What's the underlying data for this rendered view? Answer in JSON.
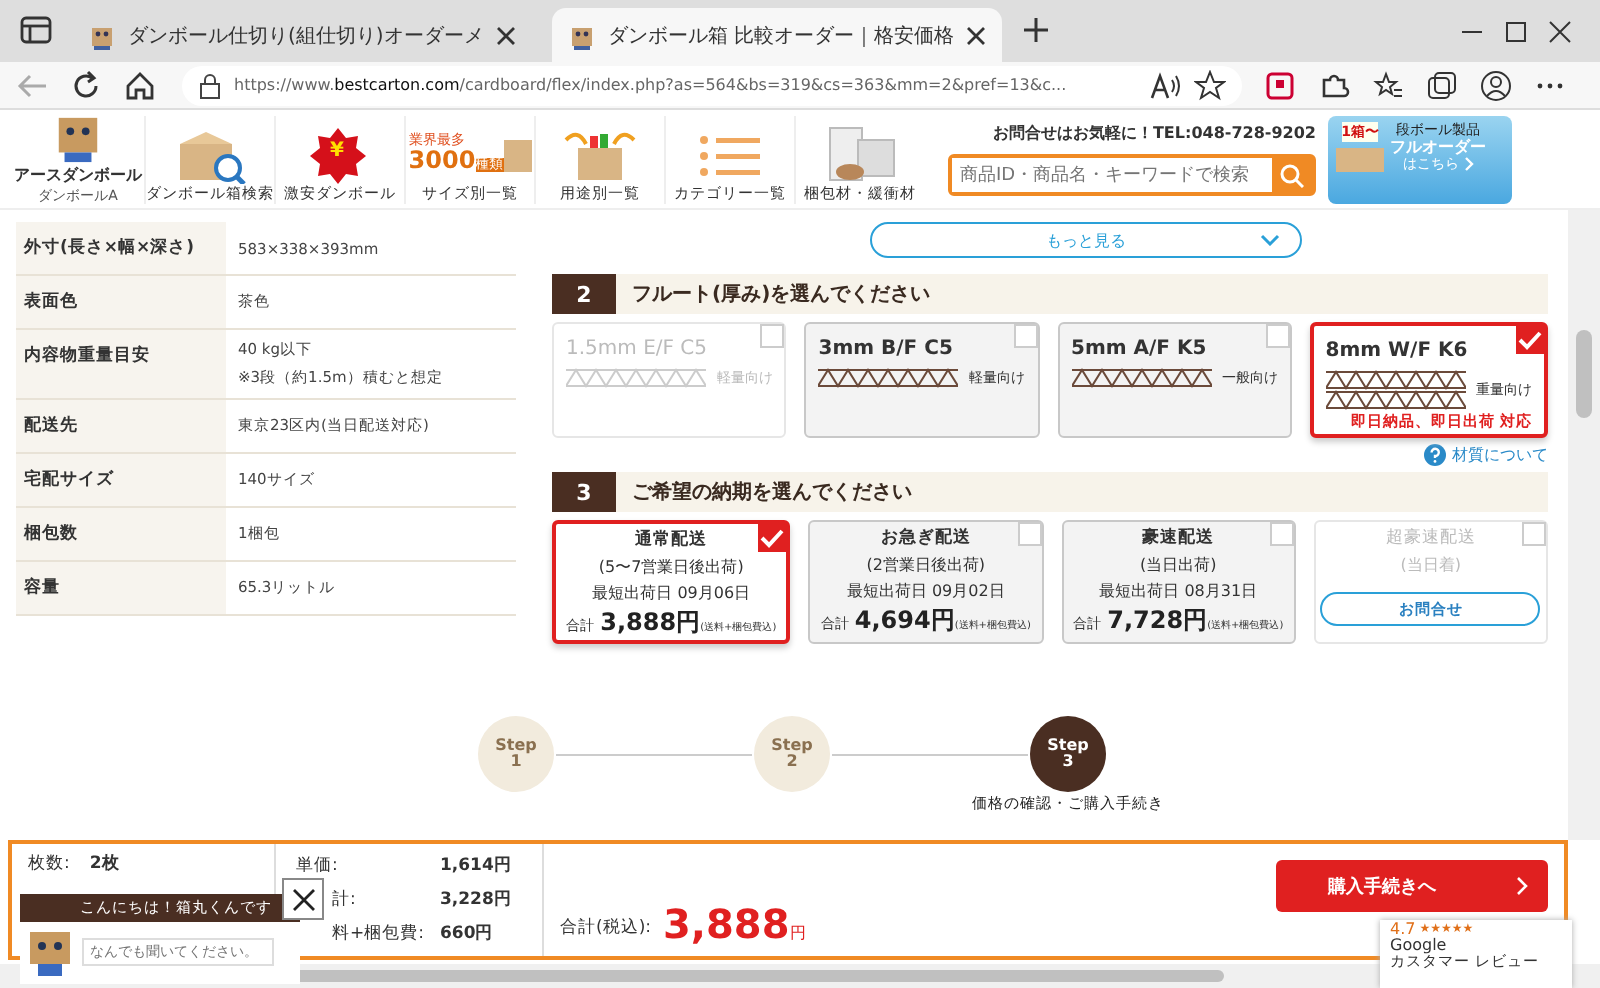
{
  "browser": {
    "tabs": [
      {
        "title": "ダンボール仕切り(組仕切り)オーダーメ",
        "selected": false
      },
      {
        "title": "ダンボール箱 比較オーダー｜格安価格",
        "selected": true
      }
    ],
    "url_prefix": "https://www.",
    "url_host": "bestcarton.com",
    "url_path": "/cardboard/flex/index.php?as=564&bs=319&cs=363&mm=2&pref=13&c..."
  },
  "header": {
    "logo": "アースダンボール",
    "logo_sub": "ダンボールA",
    "nav": [
      {
        "label": "ダンボール箱検索",
        "kind": "search"
      },
      {
        "label": "激安ダンボール",
        "kind": "sale",
        "badge": "¥"
      },
      {
        "label": "サイズ別一覧",
        "kind": "size",
        "badge_top": "業界最多",
        "badge_num": "3000",
        "badge_unit": "種類"
      },
      {
        "label": "用途別一覧",
        "kind": "use"
      },
      {
        "label": "カテゴリー一覧",
        "kind": "list"
      },
      {
        "label": "梱包材・緩衝材",
        "kind": "pack"
      }
    ],
    "contact": "お問合せはお気軽に！TEL:048-728-9202",
    "search": {
      "placeholder": "商品ID・商品名・キーワードで検索"
    },
    "banner": {
      "top": "1箱〜",
      "right_top": "段ボール製品",
      "main": "フルオーダー",
      "link": "はこちら"
    }
  },
  "specs": [
    {
      "label": "外寸(長さ×幅×深さ)",
      "values": [
        "583×338×393mm"
      ]
    },
    {
      "label": "表面色",
      "values": [
        "茶色"
      ]
    },
    {
      "label": "内容物重量目安",
      "values": [
        "40 kg以下",
        "※3段（約1.5m）積むと想定"
      ]
    },
    {
      "label": "配送先",
      "values": [
        "東京23区内(当日配送対応)"
      ]
    },
    {
      "label": "宅配サイズ",
      "values": [
        "140サイズ"
      ]
    },
    {
      "label": "梱包数",
      "values": [
        "1梱包"
      ]
    },
    {
      "label": "容量",
      "values": [
        "65.3リットル"
      ]
    }
  ],
  "more_button": "もっと見る",
  "flute": {
    "number": "2",
    "title": "フルート(厚み)を選んでください",
    "options": [
      {
        "name": "1.5mm E/F C5",
        "usage": "軽量向け",
        "kind": "single",
        "selected": false,
        "disabled": true
      },
      {
        "name": "3mm B/F C5",
        "usage": "軽量向け",
        "kind": "single",
        "selected": false,
        "disabled": false
      },
      {
        "name": "5mm A/F K5",
        "usage": "一般向け",
        "kind": "single",
        "selected": false,
        "disabled": false
      },
      {
        "name": "8mm W/F K6",
        "usage": "重量向け",
        "kind": "double",
        "note": "即日納品、即日出荷 対応",
        "selected": true,
        "disabled": false
      }
    ],
    "link": "材質について"
  },
  "delivery": {
    "number": "3",
    "title": "ご希望の納期を選んでください",
    "options": [
      {
        "name": "通常配送",
        "sub": "(5〜7営業日後出荷)",
        "date": "最短出荷日 09月06日",
        "total_label": "合計",
        "price": "3,888円",
        "price_note": "(送料+梱包費込)",
        "selected": true,
        "disabled": false
      },
      {
        "name": "お急ぎ配送",
        "sub": "(2営業日後出荷)",
        "date": "最短出荷日 09月02日",
        "total_label": "合計",
        "price": "4,694円",
        "price_note": "(送料+梱包費込)",
        "selected": false,
        "disabled": false
      },
      {
        "name": "豪速配送",
        "sub": "(当日出荷)",
        "date": "最短出荷日 08月31日",
        "total_label": "合計",
        "price": "7,728円",
        "price_note": "(送料+梱包費込)",
        "selected": false,
        "disabled": false
      },
      {
        "name": "超豪速配送",
        "sub": "(当日着)",
        "button": "お問合せ",
        "selected": false,
        "disabled": true
      }
    ]
  },
  "steps": [
    {
      "label": "Step",
      "number": "1",
      "selected": false
    },
    {
      "label": "Step",
      "number": "2",
      "selected": false
    },
    {
      "label": "Step",
      "number": "3",
      "selected": true,
      "caption": "価格の確認・ご購入手続き"
    }
  ],
  "summary": {
    "qty_label": "枚数:",
    "qty": "2枚",
    "prices": [
      {
        "label": "単価:",
        "value": "1,614円"
      },
      {
        "label": "計:",
        "value": "3,228円"
      },
      {
        "label": "料+梱包費:",
        "value": "660円"
      }
    ],
    "total_label": "合計(税込):",
    "total": "3,888",
    "total_unit": "円",
    "buy_button": "購入手続きへ"
  },
  "chat": {
    "greeting": "こんにちは！箱丸くんです",
    "placeholder": "なんでも聞いてください。"
  },
  "review": {
    "rating": "4.7",
    "stars": 5,
    "brand": "Google",
    "label": "カスタマー レビュー"
  }
}
